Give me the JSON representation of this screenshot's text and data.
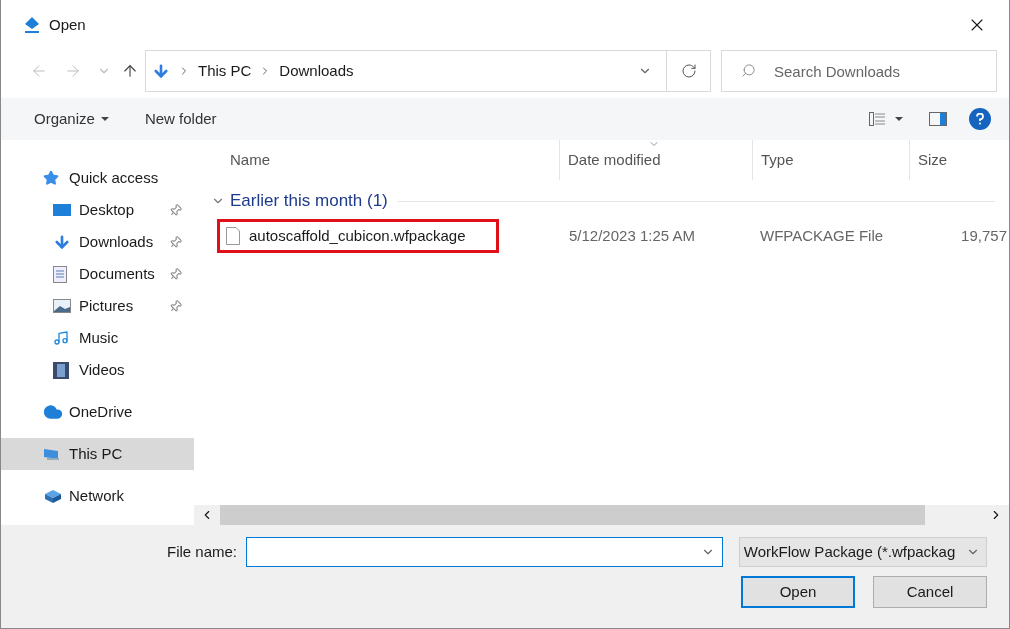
{
  "window": {
    "title": "Open"
  },
  "address": {
    "path": [
      "This PC",
      "Downloads"
    ]
  },
  "search": {
    "placeholder": "Search Downloads"
  },
  "toolbar": {
    "buttons": [
      "Organize",
      "New folder"
    ]
  },
  "nav": [
    {
      "label": "Quick access",
      "selected": false,
      "children": [
        {
          "label": "Desktop",
          "pinned": true,
          "selected": false
        },
        {
          "label": "Downloads",
          "pinned": true,
          "selected": false
        },
        {
          "label": "Documents",
          "pinned": true,
          "selected": false
        },
        {
          "label": "Pictures",
          "pinned": true,
          "selected": false
        },
        {
          "label": "Music",
          "pinned": false,
          "selected": false
        },
        {
          "label": "Videos",
          "pinned": false,
          "selected": false
        }
      ]
    },
    {
      "label": "OneDrive",
      "selected": false
    },
    {
      "label": "This PC",
      "selected": true
    },
    {
      "label": "Network",
      "selected": false
    }
  ],
  "table": {
    "columns": [
      "Name",
      "Date modified",
      "Type",
      "Size"
    ],
    "groups": [
      {
        "label": "Earlier this month (1)",
        "expanded": true,
        "rows": [
          {
            "name": "autoscaffold_cubicon.wfpackage",
            "date": "5/12/2023 1:25 AM",
            "type": "WFPACKAGE File",
            "size": "19,757",
            "highlighted": true
          }
        ]
      }
    ]
  },
  "footer": {
    "file_name_label": "File name:",
    "filter": "WorkFlow Package (*.wfpackag",
    "buttons": [
      {
        "label": "Open",
        "kind": "primary"
      },
      {
        "label": "Cancel",
        "kind": "normal"
      }
    ]
  }
}
